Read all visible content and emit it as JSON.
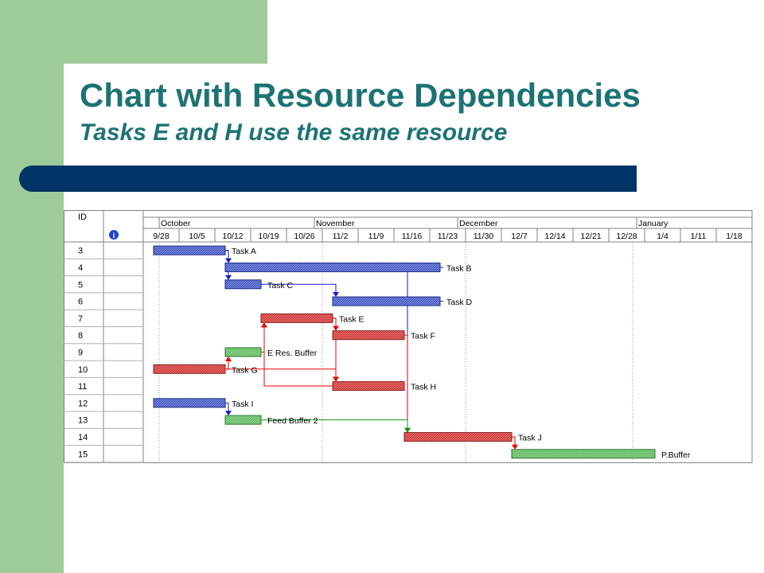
{
  "slide": {
    "title": "Chart with Resource Dependencies",
    "subtitle": "Tasks E and H use the same resource"
  },
  "gantt": {
    "id_header": "ID",
    "info_icon": "info-icon",
    "months": [
      "October",
      "November",
      "December",
      "January"
    ],
    "weeks": [
      "9/28",
      "10/5",
      "10/12",
      "10/19",
      "10/26",
      "11/2",
      "11/9",
      "11/16",
      "11/23",
      "11/30",
      "12/7",
      "12/14",
      "12/21",
      "12/28",
      "1/4",
      "1/11",
      "1/18"
    ],
    "colors": {
      "critical": "#cc3333",
      "normal": "#4455bb",
      "buffer": "#55aa55",
      "resource_link": "#ee0000",
      "normal_link": "#1a1acc",
      "buffer_link": "#119911"
    },
    "rows": [
      {
        "id": "3",
        "task": "Task A",
        "start": "9/28",
        "end": "10/12",
        "kind": "normal"
      },
      {
        "id": "4",
        "task": "Task B",
        "start": "10/12",
        "end": "11/23",
        "kind": "normal"
      },
      {
        "id": "5",
        "task": "Task C",
        "start": "10/12",
        "end": "10/19",
        "kind": "normal"
      },
      {
        "id": "6",
        "task": "Task D",
        "start": "11/2",
        "end": "11/23",
        "kind": "normal"
      },
      {
        "id": "7",
        "task": "Task E",
        "start": "10/19",
        "end": "11/2",
        "kind": "critical"
      },
      {
        "id": "8",
        "task": "Task F",
        "start": "11/2",
        "end": "11/16",
        "kind": "critical"
      },
      {
        "id": "9",
        "task": "E Res. Buffer",
        "start": "10/12",
        "end": "10/19",
        "kind": "buffer"
      },
      {
        "id": "10",
        "task": "Task G",
        "start": "9/28",
        "end": "10/12",
        "kind": "critical"
      },
      {
        "id": "11",
        "task": "Task H",
        "start": "11/2",
        "end": "11/16",
        "kind": "critical"
      },
      {
        "id": "12",
        "task": "Task I",
        "start": "9/28",
        "end": "10/12",
        "kind": "normal"
      },
      {
        "id": "13",
        "task": "Feed Buffer 2",
        "start": "10/12",
        "end": "10/19",
        "kind": "buffer"
      },
      {
        "id": "14",
        "task": "Task J",
        "start": "11/16",
        "end": "12/7",
        "kind": "critical"
      },
      {
        "id": "15",
        "task": "P.Buffer",
        "start": "12/7",
        "end": "1/4",
        "kind": "buffer"
      }
    ],
    "links": [
      {
        "from": "3",
        "to": "4",
        "kind": "normal"
      },
      {
        "from": "3",
        "to": "5",
        "kind": "normal"
      },
      {
        "from": "5",
        "to": "6",
        "kind": "normal"
      },
      {
        "from": "4",
        "to": "14",
        "kind": "normal"
      },
      {
        "from": "6",
        "to": "14",
        "kind": "normal"
      },
      {
        "from": "7",
        "to": "8",
        "kind": "critical"
      },
      {
        "from": "7",
        "to": "11",
        "kind": "resource"
      },
      {
        "from": "9",
        "to": "7",
        "kind": "buffer"
      },
      {
        "from": "10",
        "to": "9",
        "kind": "critical"
      },
      {
        "from": "10",
        "to": "11",
        "kind": "critical"
      },
      {
        "from": "11",
        "to": "7",
        "kind": "resource"
      },
      {
        "from": "8",
        "to": "14",
        "kind": "critical"
      },
      {
        "from": "12",
        "to": "13",
        "kind": "normal"
      },
      {
        "from": "13",
        "to": "14",
        "kind": "buffer"
      },
      {
        "from": "14",
        "to": "15",
        "kind": "critical"
      }
    ]
  }
}
